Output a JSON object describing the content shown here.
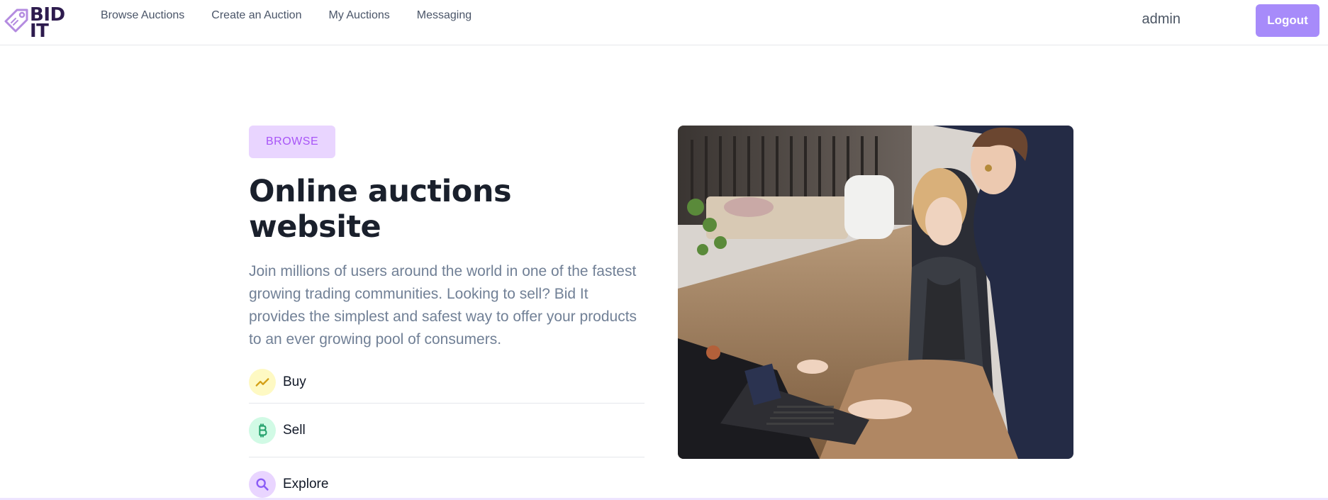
{
  "nav": {
    "logo_text": "BID IT",
    "links": [
      "Browse Auctions",
      "Create an Auction",
      "My Auctions",
      "Messaging"
    ],
    "user_name": "admin",
    "logout_label": "Logout"
  },
  "hero": {
    "badge": "BROWSE",
    "title": "Online auctions website",
    "description": "Join millions of users around the world in one of the fastest growing trading communities. Looking to sell? Bid It provides the simplest and safest way to offer your products to an ever growing pool of consumers.",
    "features": [
      {
        "label": "Buy",
        "icon": "trend-up-icon"
      },
      {
        "label": "Sell",
        "icon": "bitcoin-icon"
      },
      {
        "label": "Explore",
        "icon": "search-icon"
      }
    ]
  },
  "colors": {
    "accent": "#a78bfa",
    "badge_bg": "#e9d5ff",
    "badge_text": "#a855f7"
  }
}
